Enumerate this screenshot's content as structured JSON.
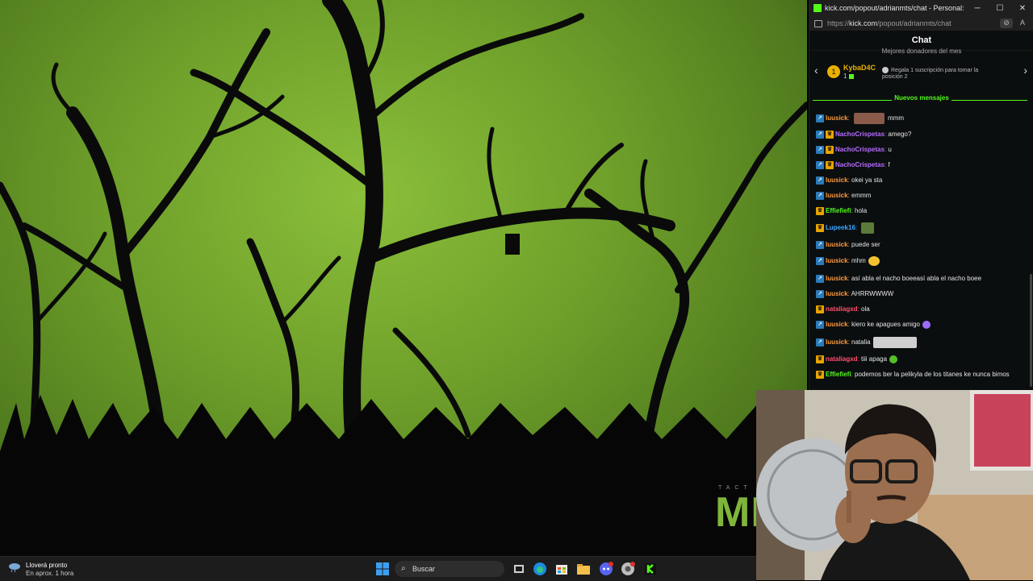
{
  "browser": {
    "title": "kick.com/popout/adrianmts/chat - Personal: Micros...",
    "window_controls": {
      "minimize": "─",
      "maximize": "☐",
      "close": "✕"
    },
    "url_prefix": "https://",
    "url_host": "kick.com",
    "url_path": "/popout/adrianmts/chat"
  },
  "chat": {
    "header": "Chat",
    "top_donors": {
      "heading": "Mejores donadores del mes",
      "rank": "1",
      "name": "KybaD4C",
      "count": "1",
      "cta": "Regala 1 suscripción para tomar la posición 2"
    },
    "new_messages_label": "Nuevos mensajes",
    "messages": [
      {
        "badges": [
          "blue"
        ],
        "user": "luusick",
        "color": "#ff9a3c",
        "text": "mmm",
        "emote": "photo"
      },
      {
        "badges": [
          "blue",
          "gold"
        ],
        "user": "NachoCrispetas",
        "color": "#b56cff",
        "text": "amego?"
      },
      {
        "badges": [
          "blue",
          "gold"
        ],
        "user": "NachoCrispetas",
        "color": "#b56cff",
        "text": "u"
      },
      {
        "badges": [
          "blue",
          "gold"
        ],
        "user": "NachoCrispetas",
        "color": "#b56cff",
        "text": "f"
      },
      {
        "badges": [
          "blue"
        ],
        "user": "luusick",
        "color": "#ff9a3c",
        "text": "okei ya sta"
      },
      {
        "badges": [
          "blue"
        ],
        "user": "luusick",
        "color": "#ff9a3c",
        "text": "emmm"
      },
      {
        "badges": [
          "gold"
        ],
        "user": "Effiefiefi",
        "color": "#53fc18",
        "text": "hola"
      },
      {
        "badges": [
          "gold"
        ],
        "user": "Lupeek16",
        "color": "#3fa9ff",
        "text": "",
        "emote": "frog"
      },
      {
        "badges": [
          "blue"
        ],
        "user": "luusick",
        "color": "#ff9a3c",
        "text": "puede ser"
      },
      {
        "badges": [
          "blue"
        ],
        "user": "luusick",
        "color": "#ff9a3c",
        "text": "mhm",
        "emote": "smile"
      },
      {
        "badges": [
          "blue"
        ],
        "user": "luusick",
        "color": "#ff9a3c",
        "text": "así abla el nacho boeeasí abla el nacho boee"
      },
      {
        "badges": [
          "blue"
        ],
        "user": "luusick",
        "color": "#ff9a3c",
        "text": "AHRRWWWW"
      },
      {
        "badges": [
          "gold"
        ],
        "user": "nataliagxd",
        "color": "#ff4f6d",
        "text": "ola"
      },
      {
        "badges": [
          "blue"
        ],
        "user": "luusick",
        "color": "#ff9a3c",
        "text": "kiero ke apagues amigo",
        "emote": "purple-heart"
      },
      {
        "badges": [
          "blue"
        ],
        "user": "luusick",
        "color": "#ff9a3c",
        "text": "natalia",
        "emote": "photo2"
      },
      {
        "badges": [
          "gold"
        ],
        "user": "nataliagxd",
        "color": "#ff4f6d",
        "text": "tiii apaga",
        "emote": "green-heart"
      },
      {
        "badges": [
          "gold"
        ],
        "user": "Effiefiefi",
        "color": "#53fc18",
        "text": "podemos ber la pelikyla de los titanes ke nunca bimos"
      }
    ]
  },
  "wallpaper": {
    "brand_small": "TACT",
    "brand_big": "ME"
  },
  "taskbar": {
    "weather_title": "Lloverá pronto",
    "weather_sub": "En aprox. 1 hora",
    "search_label": "Buscar"
  }
}
